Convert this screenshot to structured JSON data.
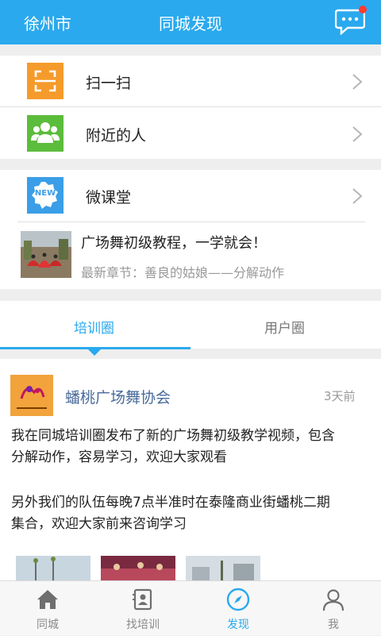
{
  "header": {
    "city": "徐州市",
    "title": "同城发现",
    "message_icon": "message-icon"
  },
  "menu": [
    {
      "label": "扫一扫",
      "icon": "scan-icon",
      "color": "#f59b2b"
    },
    {
      "label": "附近的人",
      "icon": "people-icon",
      "color": "#5cbc3c"
    },
    {
      "label": "微课堂",
      "icon": "new-badge-icon",
      "color": "#3a9ee8",
      "badge": "NEW"
    }
  ],
  "course": {
    "title": "广场舞初级教程，一学就会！",
    "subtitle": "最新章节：善良的姑娘——分解动作"
  },
  "tabs": {
    "active": "培训圈",
    "other": "用户圈"
  },
  "post": {
    "author": "蟠桃广场舞协会",
    "time": "3天前",
    "line1": "我在同城培训圈发布了新的广场舞初级教学视频，包含",
    "line2": "分解动作，容易学习，欢迎大家观看",
    "line3": "另外我们的队伍每晚7点半准时在泰隆商业街蟠桃二期",
    "line4": "集合，欢迎大家前来咨询学习"
  },
  "bottom_nav": [
    {
      "label": "同城",
      "icon": "home-icon"
    },
    {
      "label": "找培训",
      "icon": "training-icon"
    },
    {
      "label": "发现",
      "icon": "compass-icon",
      "active": true
    },
    {
      "label": "我",
      "icon": "user-icon"
    }
  ],
  "colors": {
    "accent": "#2aa9ee",
    "background": "#eeeeee"
  }
}
